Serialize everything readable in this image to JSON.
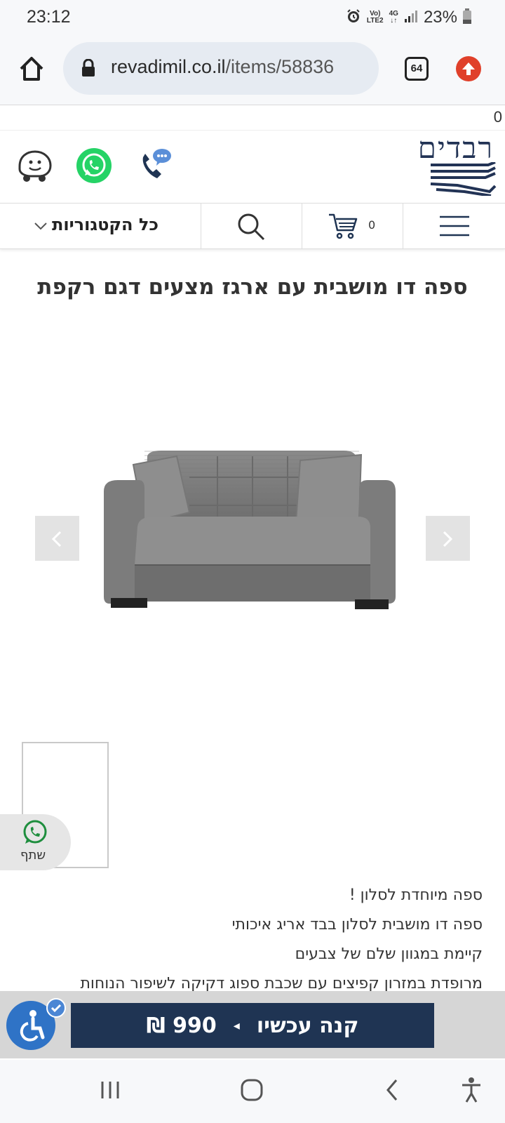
{
  "status_bar": {
    "time": "23:12",
    "net_top": "Vo)",
    "net_bottom": "LTE2",
    "data_top": "4G",
    "battery": "23%"
  },
  "browser": {
    "url_domain": "revadimil.co.il",
    "url_path": "/items/58836",
    "tab_count": "64"
  },
  "header": {
    "cart_count_top": "0",
    "logo_text": "רבדים"
  },
  "nav": {
    "categories_label": "כל הקטגוריות",
    "cart_count": "0"
  },
  "product": {
    "title": "ספה דו מושבית עם ארגז מצעים דגם רקפת",
    "description_lines": [
      "ספה מיוחדת לסלון !",
      "ספה דו מושבית לסלון בבד אריג איכותי",
      "קיימת במגוון שלם של צבעים",
      "מרופדת במזרון קפיצים עם שכבת ספוג דקיקה לשיפור הנוחות"
    ]
  },
  "share": {
    "label": "שתף"
  },
  "buy_bar": {
    "buy_label": "קנה עכשיו",
    "price": "990",
    "currency": "₪"
  },
  "colors": {
    "brand_navy": "#1f3453",
    "whatsapp_green": "#25d366",
    "accessibility_blue": "#2f73c6",
    "browser_upload_red": "#e0402a"
  }
}
